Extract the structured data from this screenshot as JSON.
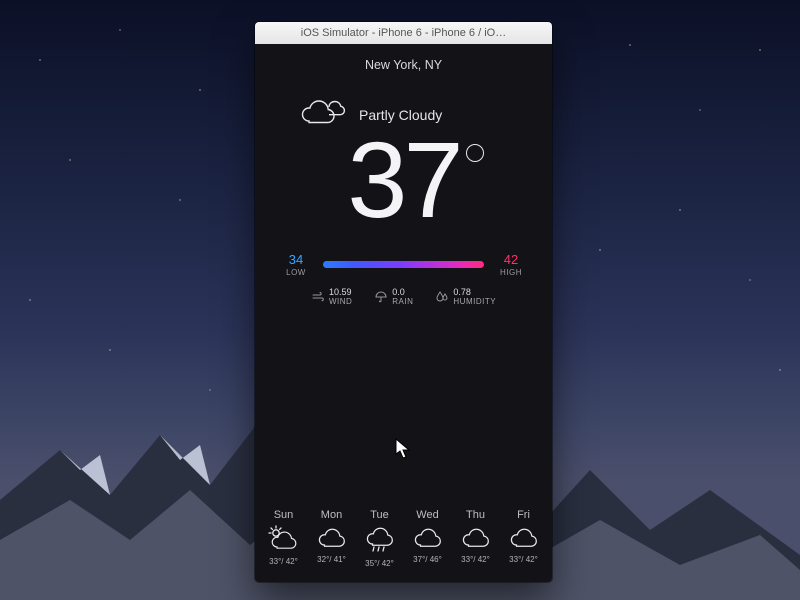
{
  "window_title": "iOS Simulator - iPhone 6 - iPhone 6 / iO…",
  "location": "New York, NY",
  "condition": {
    "icon": "cloud-icon",
    "label": "Partly Cloudy"
  },
  "current_temp": "37",
  "degree_symbol": "°",
  "range": {
    "low_value": "34",
    "low_label": "LOW",
    "high_value": "42",
    "high_label": "HIGH",
    "gradient_from": "#2c7bff",
    "gradient_to": "#ff2b7a"
  },
  "metrics": {
    "wind": {
      "icon": "wind-icon",
      "value": "10.59",
      "label": "WIND"
    },
    "rain": {
      "icon": "umbrella-icon",
      "value": "0.0",
      "label": "RAIN"
    },
    "humidity": {
      "icon": "droplet-icon",
      "value": "0.78",
      "label": "HUMIDITY"
    }
  },
  "forecast": [
    {
      "day": "Sun",
      "icon": "partly-sunny-icon",
      "low": "33",
      "high": "42"
    },
    {
      "day": "Mon",
      "icon": "cloud-icon",
      "low": "32",
      "high": "41"
    },
    {
      "day": "Tue",
      "icon": "rain-icon",
      "low": "35",
      "high": "42"
    },
    {
      "day": "Wed",
      "icon": "cloud-icon",
      "low": "37",
      "high": "46"
    },
    {
      "day": "Thu",
      "icon": "cloud-icon",
      "low": "33",
      "high": "42"
    },
    {
      "day": "Fri",
      "icon": "cloud-icon",
      "low": "33",
      "high": "42"
    }
  ],
  "colors": {
    "accent_low": "#3aa4ff",
    "accent_high": "#ff2f6e",
    "app_bg": "#131217"
  }
}
